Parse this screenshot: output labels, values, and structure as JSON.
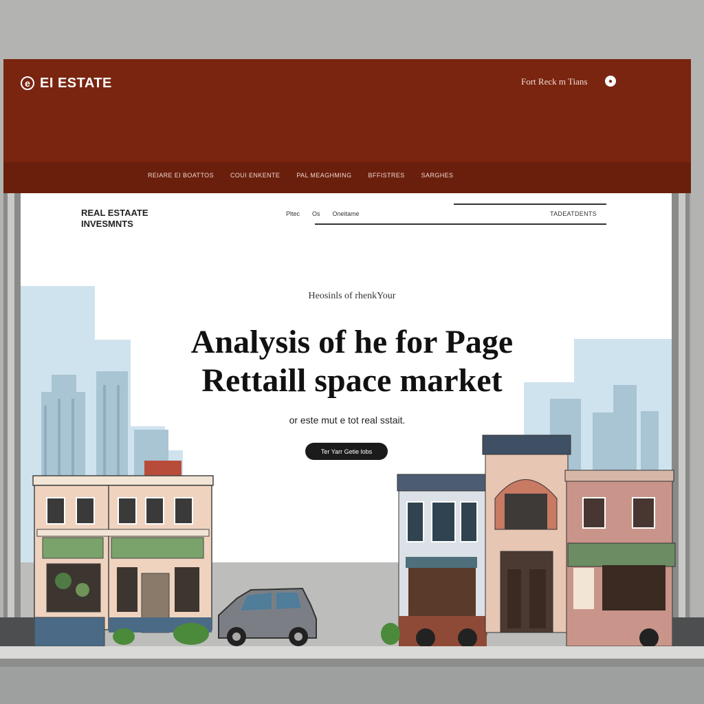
{
  "header": {
    "brand_logo_letter": "e",
    "brand_text": "EI ESTATE",
    "top_link": "Fort Reck m  Tians",
    "icon": "user-circle-icon"
  },
  "nav": {
    "items": [
      "REIARE EI BOATTOS",
      "COUI ENKENTE",
      "PAL MEAGHMING",
      "BFFISTRES",
      "SARGHES"
    ]
  },
  "page": {
    "site_title_line1": "REAL ESTAATE",
    "site_title_line2": "INVESMNTS",
    "sub_links": [
      "Pltec",
      "Os",
      "Oneitame"
    ],
    "sub_right": "TADEATDENTS",
    "eyebrow": "Heosinls of rhenkYour",
    "headline_line1": "Analysis of he for Page",
    "headline_line2": "Rettaill space market",
    "subtext": "or este mut e tot real sstait.",
    "cta_label": "Ter Yarr Getie lobs"
  },
  "colors": {
    "header": "#7a2510",
    "nav": "#6a1f0d",
    "cta": "#1b1b1b",
    "skyline": "#cfe3ee"
  }
}
